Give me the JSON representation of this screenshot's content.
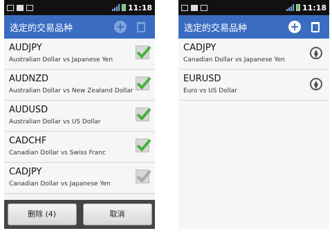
{
  "status": {
    "time": "11:18"
  },
  "left": {
    "title": "选定的交易品种",
    "items": [
      {
        "symbol": "AUDJPY",
        "desc": "Australian Dollar vs Japanese Yen",
        "checked": true
      },
      {
        "symbol": "AUDNZD",
        "desc": "Australian Dollar vs New Zealand Dollar",
        "checked": true
      },
      {
        "symbol": "AUDUSD",
        "desc": "Australian Dollar vs US Dollar",
        "checked": true
      },
      {
        "symbol": "CADCHF",
        "desc": "Canadian Dollar vs Swiss Franc",
        "checked": true
      },
      {
        "symbol": "CADJPY",
        "desc": "Canadian Dollar vs Japanese Yen",
        "checked": false
      }
    ],
    "delete_label": "删除 (4)",
    "cancel_label": "取消"
  },
  "right": {
    "title": "选定的交易品种",
    "items": [
      {
        "symbol": "CADJPY",
        "desc": "Canadian Dollar vs Japanese Yen"
      },
      {
        "symbol": "EURUSD",
        "desc": "Euro vs US Dollar"
      }
    ]
  },
  "colors": {
    "appbar": "#3a6dc2",
    "check": "#44b23a"
  },
  "icons": [
    "mail-icon",
    "usb-icon",
    "signal-icon",
    "battery-icon",
    "add-icon",
    "trash-icon",
    "checkmark-icon",
    "reorder-icon"
  ]
}
